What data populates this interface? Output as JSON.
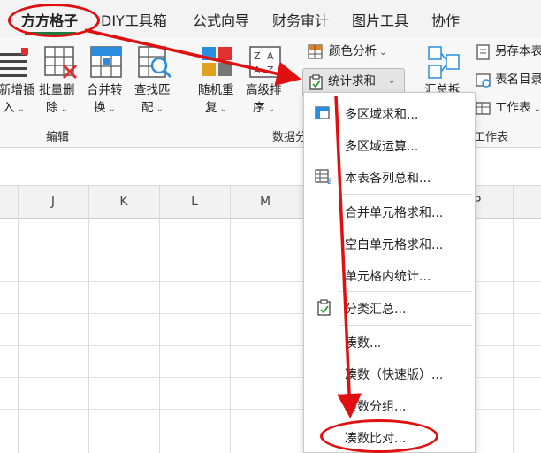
{
  "menubar": {
    "tabs": [
      {
        "label": "方方格子"
      },
      {
        "label": "DIY工具箱"
      },
      {
        "label": "公式向导"
      },
      {
        "label": "财务审计"
      },
      {
        "label": "图片工具"
      },
      {
        "label": "协作"
      }
    ]
  },
  "ribbon": {
    "edit_group": {
      "label": "编辑",
      "buttons": [
        {
          "line1": "新增插",
          "line2": "入"
        },
        {
          "line1": "批量删",
          "line2": "除"
        },
        {
          "line1": "合并转",
          "line2": "换"
        },
        {
          "line1": "查找匹",
          "line2": "配"
        }
      ]
    },
    "data_group": {
      "label": "数据分",
      "buttons": [
        {
          "line1": "随机重",
          "line2": "复"
        },
        {
          "line1": "高级排",
          "line2": "序"
        }
      ],
      "color_analysis": "颜色分析",
      "stat_sum": "统计求和"
    },
    "summary_btn": "汇总拆",
    "sheet_group": {
      "label": "工作表",
      "items": [
        {
          "label": "另存本表"
        },
        {
          "label": "表名目录"
        },
        {
          "label": "工作表"
        }
      ]
    }
  },
  "sheet": {
    "columns": [
      "J",
      "K",
      "L",
      "M",
      "P"
    ]
  },
  "dropdown": {
    "items": [
      {
        "label": "多区域求和...",
        "icon": "multi-area-sum-icon"
      },
      {
        "label": "多区域运算...",
        "icon": ""
      },
      {
        "label": "本表各列总和...",
        "icon": "column-sum-icon"
      },
      {
        "label": "合并单元格求和...",
        "icon": ""
      },
      {
        "label": "空白单元格求和...",
        "icon": ""
      },
      {
        "label": "单元格内统计...",
        "icon": ""
      },
      {
        "label": "分类汇总...",
        "icon": "clipboard-check-icon"
      },
      {
        "label": "凑数...",
        "icon": ""
      },
      {
        "label": "凑数（快速版）...",
        "icon": ""
      },
      {
        "label": "凑数分组...",
        "icon": ""
      },
      {
        "label": "凑数比对...",
        "icon": ""
      }
    ]
  },
  "colors": {
    "annotation_red": "#e01010",
    "active_tab_accent": "#1b7a3e"
  }
}
